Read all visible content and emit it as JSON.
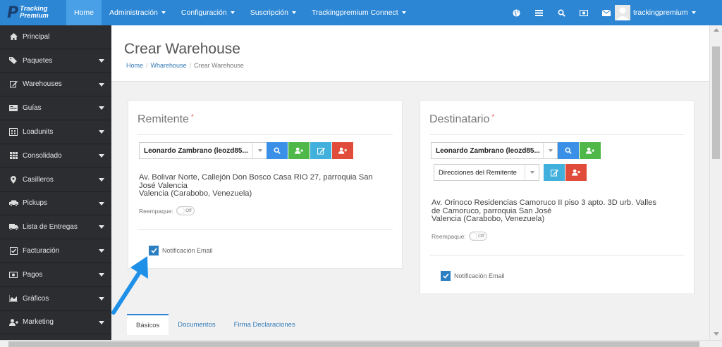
{
  "brand": {
    "line1": "Tracking",
    "line2": "Premium",
    "mark": "P"
  },
  "nav": {
    "items": [
      {
        "label": "Home",
        "active": true,
        "dropdown": false
      },
      {
        "label": "Administración",
        "active": false,
        "dropdown": true
      },
      {
        "label": "Configuración",
        "active": false,
        "dropdown": true
      },
      {
        "label": "Suscripción",
        "active": false,
        "dropdown": true
      },
      {
        "label": "Trackingpremium Connect",
        "active": false,
        "dropdown": true
      }
    ],
    "icons": [
      "globe-icon",
      "list-icon",
      "search-icon",
      "money-icon",
      "envelope-icon"
    ],
    "user": "trackingpremium"
  },
  "sidebar": {
    "items": [
      {
        "label": "Principal",
        "icon": "home-icon",
        "dropdown": false
      },
      {
        "label": "Paquetes",
        "icon": "tags-icon",
        "dropdown": true
      },
      {
        "label": "Warehouses",
        "icon": "edit-icon",
        "dropdown": true
      },
      {
        "label": "Guías",
        "icon": "card-icon",
        "dropdown": true
      },
      {
        "label": "Loadunits",
        "icon": "building-icon",
        "dropdown": true
      },
      {
        "label": "Consolidado",
        "icon": "table-icon",
        "dropdown": true
      },
      {
        "label": "Casilleros",
        "icon": "map-marker-icon",
        "dropdown": true
      },
      {
        "label": "Pickups",
        "icon": "car-icon",
        "dropdown": true
      },
      {
        "label": "Lista de Entregas",
        "icon": "truck-icon",
        "dropdown": true
      },
      {
        "label": "Facturación",
        "icon": "check-square-icon",
        "dropdown": true
      },
      {
        "label": "Pagos",
        "icon": "money-icon",
        "dropdown": true
      },
      {
        "label": "Gráficos",
        "icon": "area-chart-icon",
        "dropdown": true
      },
      {
        "label": "Marketing",
        "icon": "user-plus-icon",
        "dropdown": true
      }
    ]
  },
  "page": {
    "title": "Crear Warehouse",
    "breadcrumb": [
      "Home",
      "Wharehouse",
      "Crear Warehouse"
    ]
  },
  "remitente": {
    "title": "Remitente",
    "required_mark": "*",
    "selected": "Leonardo Zambrano (leozd85...",
    "address_line1": "Av. Bolivar Norte, Callejón Don Bosco Casa RIO 27, parroquia San",
    "address_line2": "José Valencia",
    "address_line3": "Valencia (Carabobo, Venezuela)",
    "reempaque_label": "Reempaque:",
    "toggle_label": "Off",
    "email_label": "Notificación Email",
    "email_checked": true
  },
  "destinatario": {
    "title": "Destinatario",
    "required_mark": "*",
    "selected": "Leonardo Zambrano (leozd85...",
    "direcciones": "Direcciones del Remitente",
    "address_line1": "Av. Orinoco Residencias Camoruco II piso 3 apto. 3D urb. Valles",
    "address_line2": "de Camoruco, parroquia San José",
    "address_line3": "Valencia (Carabobo, Venezuela)",
    "reempaque_label": "Reempaque:",
    "toggle_label": "Off",
    "email_label": "Notificación Email",
    "email_checked": true
  },
  "tabs": [
    {
      "label": "Básicos",
      "active": true
    },
    {
      "label": "Documentos",
      "active": false
    },
    {
      "label": "Firma Declaraciones",
      "active": false
    }
  ],
  "colors": {
    "nav": "#2c86d4",
    "sidebar": "#2b2d30",
    "annotation_arrow": "#1e90e8"
  }
}
